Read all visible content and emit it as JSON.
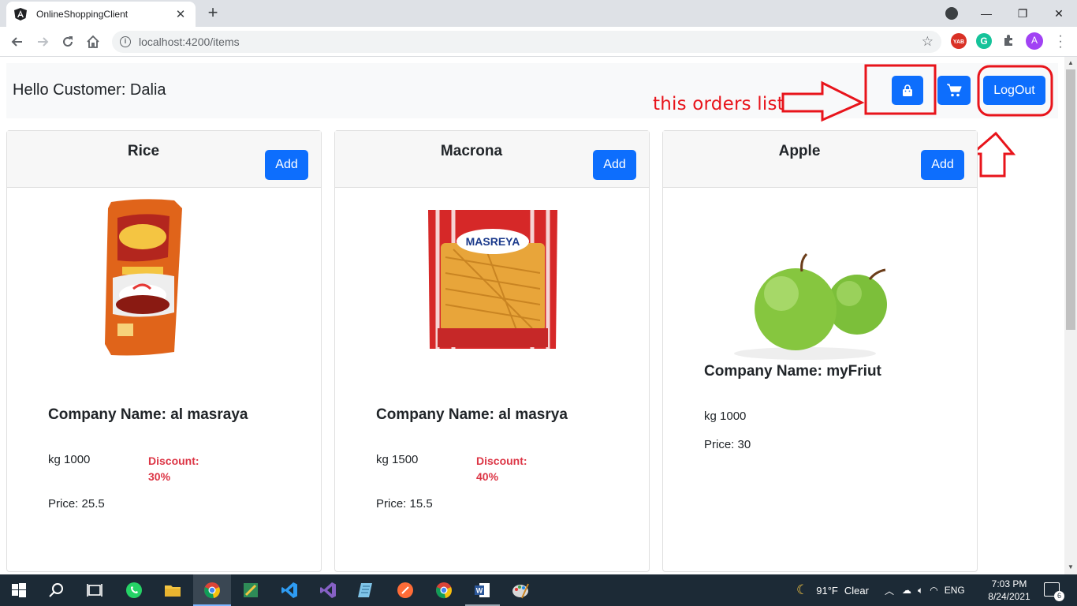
{
  "browser": {
    "tab_title": "OnlineShoppingClient",
    "tab_close": "✕",
    "new_tab": "+",
    "url": "localhost:4200/items",
    "window_controls": {
      "minimize": "—",
      "maximize": "❐",
      "close": "✕"
    },
    "extensions": [
      {
        "name": "yab-extension-icon",
        "label": "YAB",
        "color": "#d93025"
      },
      {
        "name": "grammarly-icon",
        "label": "G",
        "color": "#15c39a"
      },
      {
        "name": "extensions-puzzle-icon",
        "label": "",
        "color": "#5f6368"
      },
      {
        "name": "profile-avatar",
        "label": "A",
        "color": "#a142f4"
      }
    ]
  },
  "header": {
    "greeting": "Hello Customer: Dalia",
    "logout_label": "LogOut",
    "orders_icon": "shopping-bag-icon",
    "cart_icon": "shopping-cart-icon"
  },
  "annotation": {
    "text": "this orders list",
    "color": "#e8141b"
  },
  "products": [
    {
      "name": "Rice",
      "add_label": "Add",
      "company": "Company Name: al masraya",
      "weight": "kg 1000",
      "discount_label": "Discount:",
      "discount_value": "30%",
      "price": "Price: 25.5"
    },
    {
      "name": "Macrona",
      "add_label": "Add",
      "company": "Company Name: al masrya",
      "weight": "kg 1500",
      "discount_label": "Discount:",
      "discount_value": "40%",
      "price": "Price: 15.5"
    },
    {
      "name": "Apple",
      "add_label": "Add",
      "company": "Company Name: myFriut",
      "weight": "kg 1000",
      "price": "Price: 30"
    }
  ],
  "product_image_text": {
    "macaroni_brand": "MASREYA"
  },
  "colors": {
    "primary": "#0d6efd",
    "discount": "#dc3545",
    "taskbar": "#1c2a36"
  },
  "taskbar": {
    "weather_temp": "91°F",
    "weather_desc": "Clear",
    "language": "ENG",
    "time": "7:03 PM",
    "date": "8/24/2021",
    "notification_count": "6"
  }
}
